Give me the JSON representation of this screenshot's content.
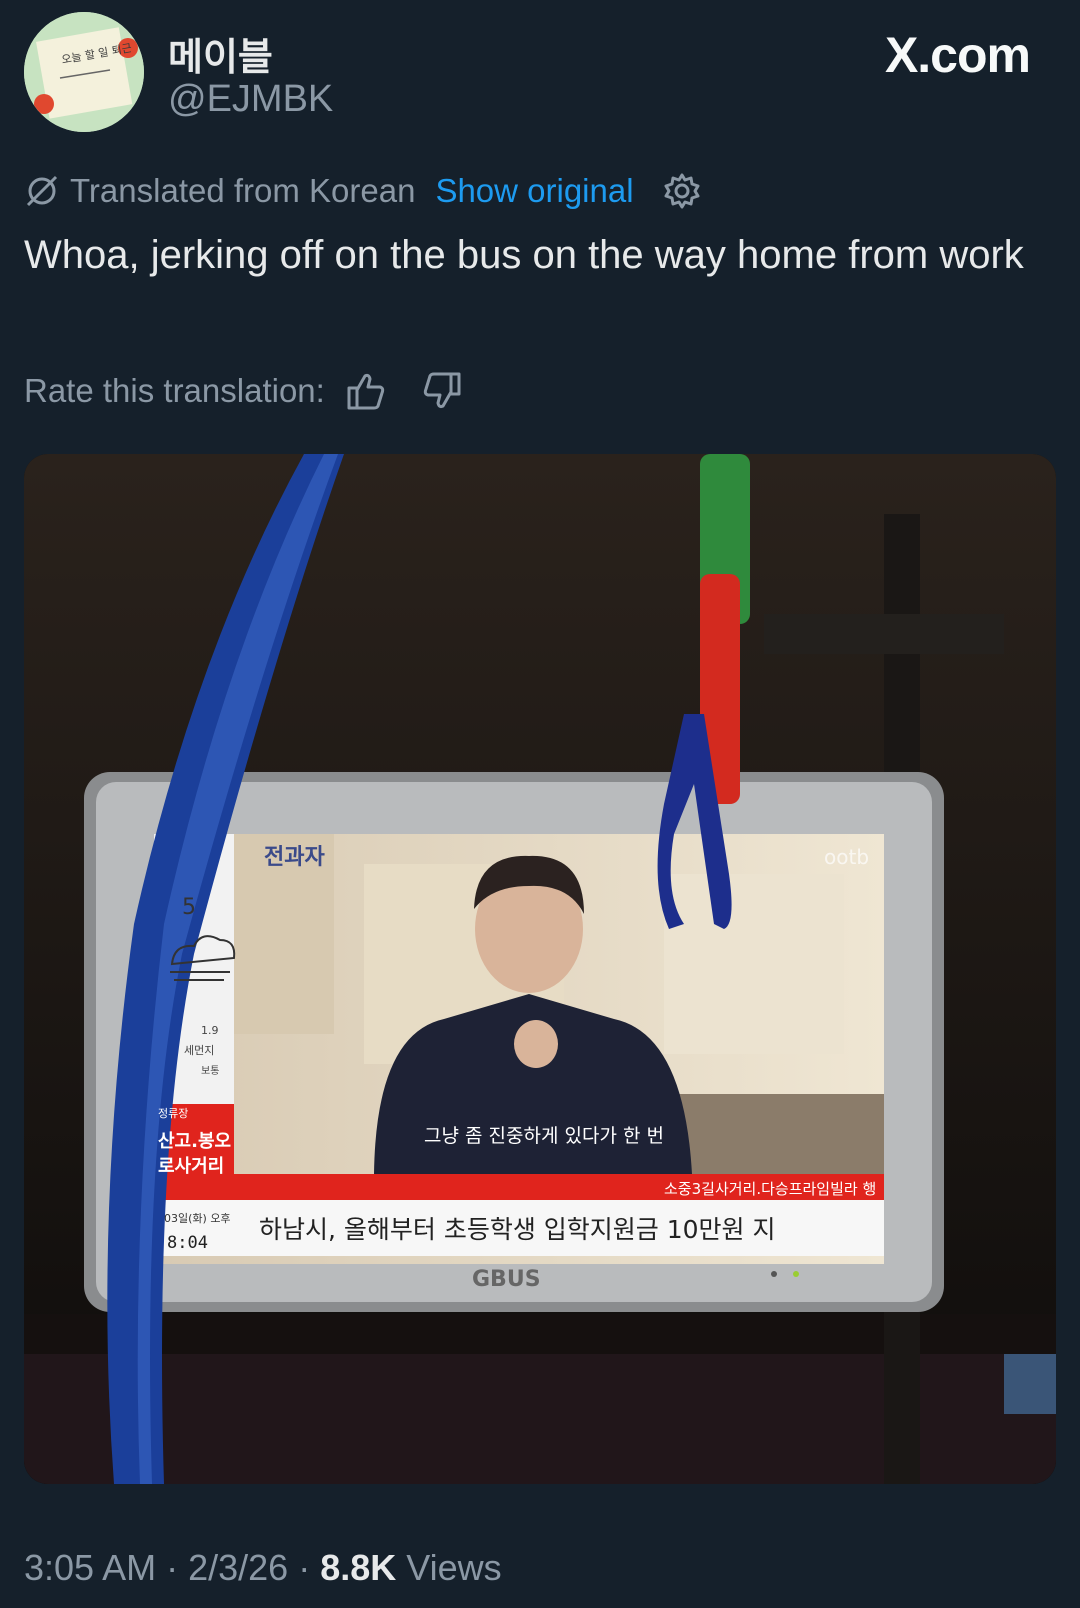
{
  "author": {
    "display_name": "메이블",
    "handle": "@EJMBK",
    "avatar_note_text": "오늘 할 일 퇴근"
  },
  "brand": "X.com",
  "translation": {
    "label": "Translated from Korean",
    "show_original": "Show original",
    "rate_label": "Rate this translation:"
  },
  "tweet_text": "Whoa, jerking off on the bus on the way home from work",
  "media": {
    "tv_channel_logo": "전과자",
    "tv_watermark": "ootb",
    "tv_subtitle": "그냥 좀 진중하게 있다가 한 번",
    "tv_next_stop": "소중3길사거리.다승프라임빌라 행",
    "tv_ticker": "하남시, 올해부터 초등학생 입학지원금 10만원 지",
    "tv_date": "03일(화) 오후",
    "tv_time": "8:04",
    "tv_side_label": "정류장",
    "tv_side_stop_1": "산고.봉오",
    "tv_side_stop_2": "로사거리",
    "tv_side_temp": "5",
    "tv_side_dust_label": "세먼지",
    "tv_side_dust_value": "1.9",
    "tv_side_status": "보통",
    "tv_bezel_brand": "GBUS"
  },
  "meta": {
    "time": "3:05 AM",
    "date": "2/3/26",
    "views_count": "8.8K",
    "views_label": "Views"
  },
  "colors": {
    "background": "#15202b",
    "link": "#1d9bf0",
    "muted": "#8b98a5",
    "text": "#e7e9ea"
  }
}
